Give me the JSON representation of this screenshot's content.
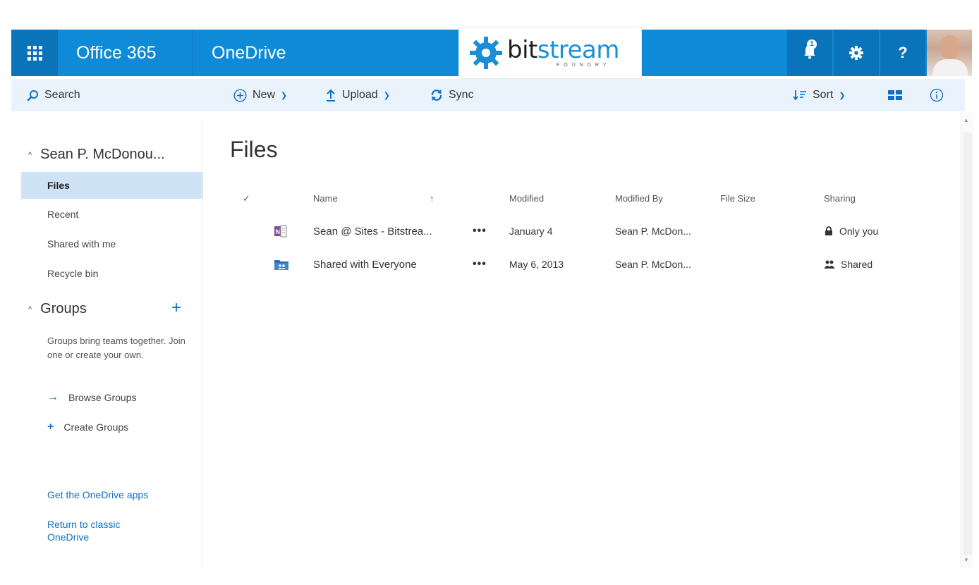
{
  "suitebar": {
    "app_launcher_icon": "waffle-grid-icon",
    "suite_name": "Office 365",
    "app_name": "OneDrive",
    "logo_word_part1": "bit",
    "logo_word_part2": "stream",
    "logo_subtext": "FOUNDRY",
    "notification_count": "1",
    "help_label": "?",
    "colors": {
      "bar": "#0f8ad6",
      "bar_dark": "#0a74ba",
      "logo_blue": "#1a8fd6"
    }
  },
  "commandbar": {
    "search_label": "Search",
    "new_label": "New",
    "upload_label": "Upload",
    "sync_label": "Sync",
    "sort_label": "Sort"
  },
  "leftnav": {
    "user_name": "Sean P. McDonou...",
    "items": [
      {
        "label": "Files",
        "active": true
      },
      {
        "label": "Recent",
        "active": false
      },
      {
        "label": "Shared with me",
        "active": false
      },
      {
        "label": "Recycle bin",
        "active": false
      }
    ],
    "groups_heading": "Groups",
    "groups_description": "Groups bring teams together. Join one or create your own.",
    "browse_groups": "Browse Groups",
    "create_groups": "Create Groups",
    "get_apps": "Get the OneDrive apps",
    "return_classic": "Return to classic OneDrive"
  },
  "main": {
    "title": "Files",
    "columns": {
      "check": "✓",
      "name": "Name",
      "sort_indicator": "↑",
      "modified": "Modified",
      "modified_by": "Modified By",
      "file_size": "File Size",
      "sharing": "Sharing"
    },
    "files": [
      {
        "name": "Sean @ Sites - Bitstrea...",
        "type_icon": "onenote-notebook-icon",
        "more": "•••",
        "modified": "January 4",
        "modified_by": "Sean P. McDon...",
        "file_size": "",
        "sharing_icon": "lock-icon",
        "sharing": "Only you"
      },
      {
        "name": "Shared with Everyone",
        "type_icon": "shared-folder-icon",
        "more": "•••",
        "modified": "May 6, 2013",
        "modified_by": "Sean P. McDon...",
        "file_size": "",
        "sharing_icon": "people-icon",
        "sharing": "Shared"
      }
    ]
  }
}
